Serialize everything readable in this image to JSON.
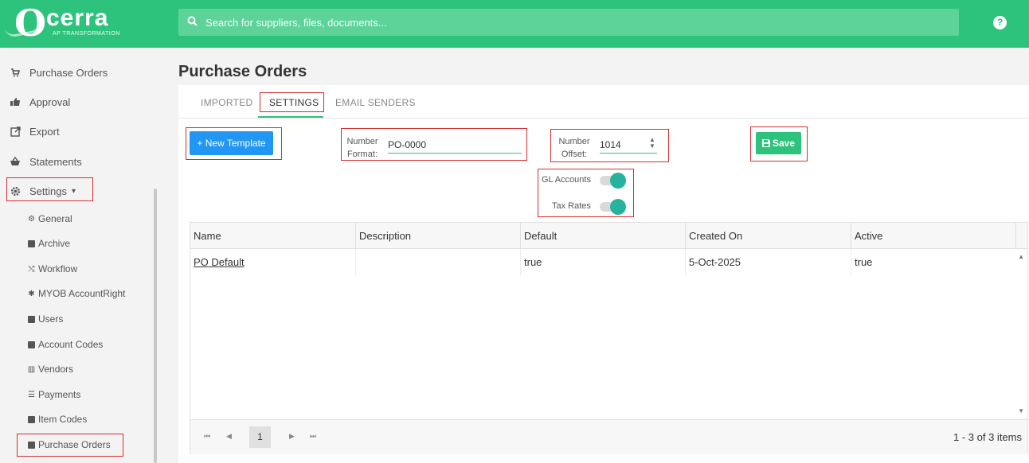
{
  "header": {
    "logo_letter": "O",
    "logo_word": "cerra",
    "logo_tagline": "AP TRANSFORMATION",
    "search_placeholder": "Search for suppliers, files, documents...",
    "help_label": "?"
  },
  "sidebar": {
    "items": [
      {
        "label": "Purchase Orders",
        "icon": "cart-icon"
      },
      {
        "label": "Approval",
        "icon": "thumbs-icon"
      },
      {
        "label": "Export",
        "icon": "export-icon"
      },
      {
        "label": "Statements",
        "icon": "basket-icon"
      },
      {
        "label": "Settings",
        "icon": "gear-icon"
      }
    ],
    "settings_caret": "▾",
    "sub_items": [
      {
        "label": "General",
        "icon": "gear-icon"
      },
      {
        "label": "Archive",
        "icon": "archive-icon"
      },
      {
        "label": "Workflow",
        "icon": "workflow-icon"
      },
      {
        "label": "MYOB AccountRight",
        "icon": "puzzle-icon"
      },
      {
        "label": "Users",
        "icon": "users-icon"
      },
      {
        "label": "Account Codes",
        "icon": "account-codes-icon"
      },
      {
        "label": "Vendors",
        "icon": "vendors-icon"
      },
      {
        "label": "Payments",
        "icon": "payments-icon"
      },
      {
        "label": "Item Codes",
        "icon": "item-codes-icon"
      },
      {
        "label": "Purchase Orders",
        "icon": "purchase-orders-icon"
      }
    ]
  },
  "main": {
    "title": "Purchase Orders",
    "tabs": [
      {
        "label": "IMPORTED",
        "active": false
      },
      {
        "label": "SETTINGS",
        "active": true
      },
      {
        "label": "EMAIL SENDERS",
        "active": false
      }
    ],
    "new_template_label": "+ New Template",
    "number_format": {
      "label_line1": "Number",
      "label_line2": "Format:",
      "value": "PO-0000"
    },
    "number_offset": {
      "label_line1": "Number",
      "label_line2": "Offset:",
      "value": "1014"
    },
    "save_label": "Save",
    "toggles": [
      {
        "label": "GL Accounts",
        "on": true
      },
      {
        "label": "Tax Rates",
        "on": true
      }
    ],
    "grid": {
      "columns": [
        "Name",
        "Description",
        "Default",
        "Created On",
        "Active"
      ],
      "rows": [
        {
          "name": "PO Default",
          "description": "",
          "default": "true",
          "created_on": "5-Oct-2025",
          "active": "true"
        }
      ],
      "current_page": "1",
      "page_info": "1 - 3 of 3 items"
    }
  },
  "colors": {
    "brand_green": "#2ec37c",
    "primary_blue": "#2196f3",
    "toggle_teal": "#26b39e",
    "highlight_red": "#d32f2f"
  }
}
